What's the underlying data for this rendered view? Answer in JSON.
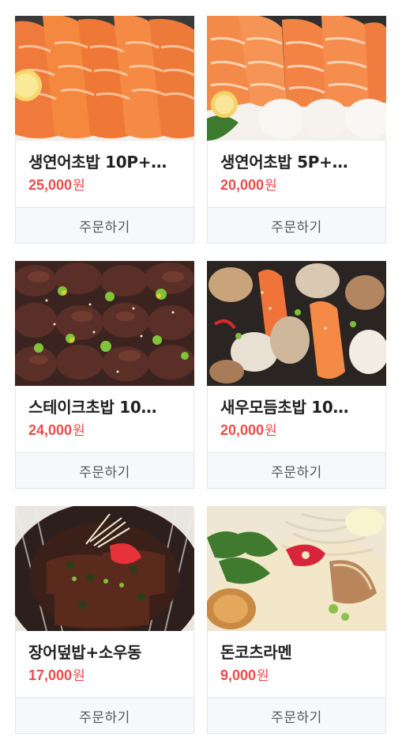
{
  "menu": {
    "currency": "원",
    "order_label": "주문하기",
    "items": [
      {
        "name": "생연어초밥 10P+…",
        "price": "25,000",
        "image": "salmon-sushi-photo"
      },
      {
        "name": "생연어초밥 5P+…",
        "price": "20,000",
        "image": "salmon-sushi-photo"
      },
      {
        "name": "스테이크초밥 10…",
        "price": "24,000",
        "image": "steak-sushi-photo"
      },
      {
        "name": "새우모듬초밥 10…",
        "price": "20,000",
        "image": "shrimp-sushi-photo"
      },
      {
        "name": "장어덮밥+소우동",
        "price": "17,000",
        "image": "eel-rice-bowl-photo"
      },
      {
        "name": "돈코츠라멘",
        "price": "9,000",
        "image": "tonkotsu-ramen-photo"
      }
    ]
  },
  "colors": {
    "price": "#ef4b4b",
    "name": "#222222",
    "button_bg": "#f7f8fa",
    "button_text": "#555555"
  }
}
